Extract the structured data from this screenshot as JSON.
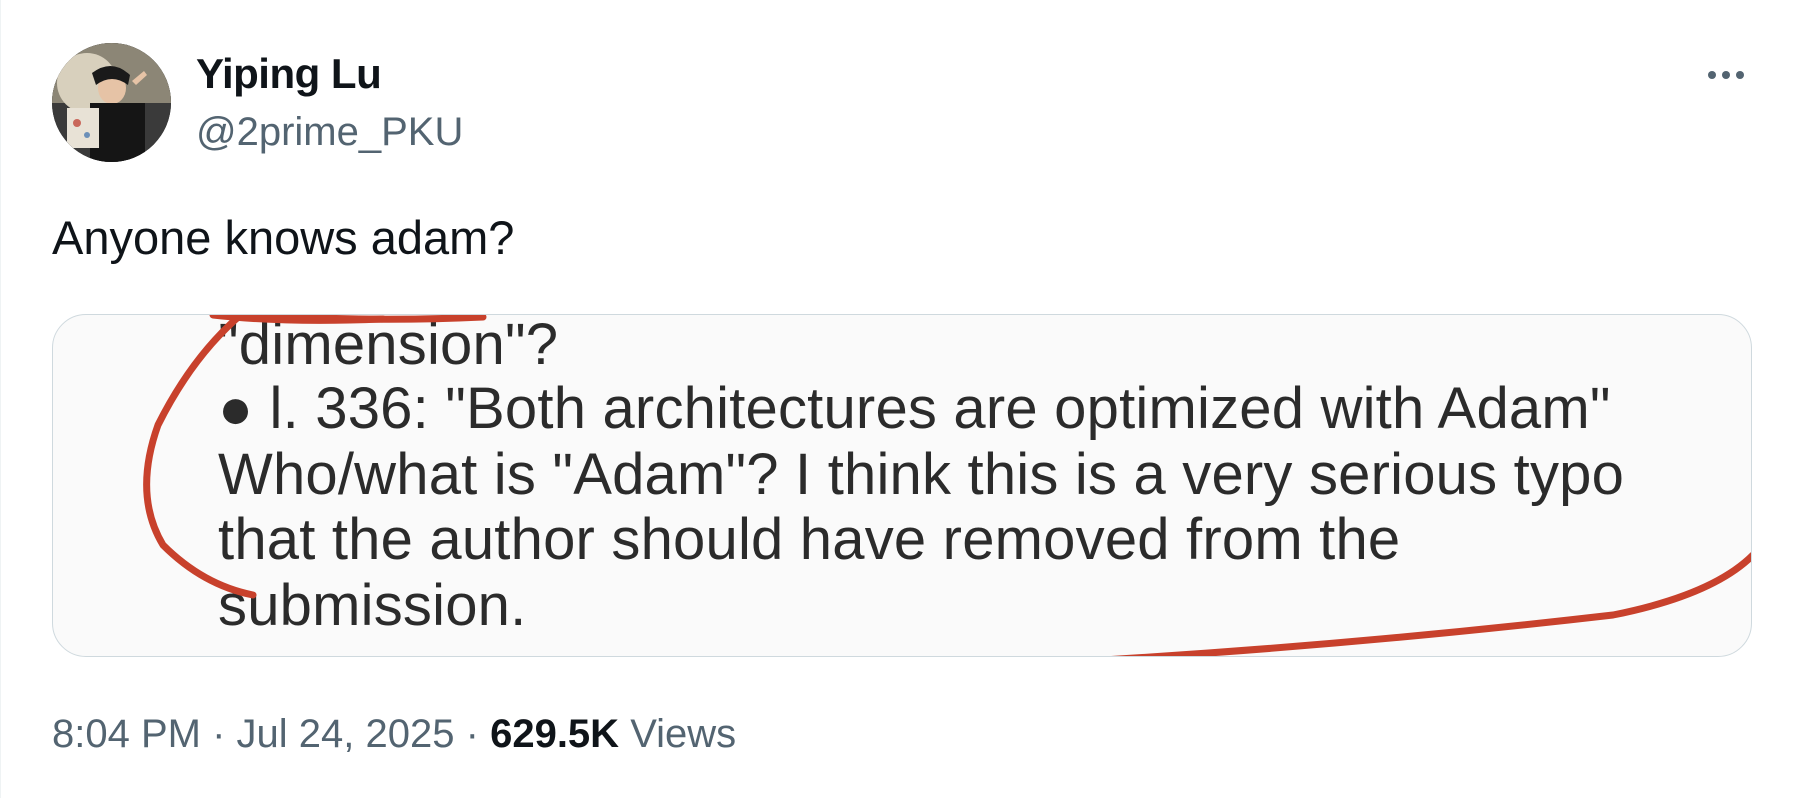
{
  "author": {
    "display_name": "Yiping Lu",
    "handle": "@2prime_PKU",
    "avatar_icon": "avatar-photo"
  },
  "more_icon": "more-horizontal-icon",
  "tweet": {
    "text": "Anyone knows adam?"
  },
  "media": {
    "lines": [
      "\"dimension\"?",
      "● l. 336: \"Both architectures are optimized with Adam\"",
      "Who/what is \"Adam\"? I think this is a very serious typo",
      "that the author should have removed from the",
      "submission."
    ],
    "annotation_color": "#c8412c"
  },
  "meta": {
    "time": "8:04 PM",
    "separator": "·",
    "date": "Jul 24, 2025",
    "views_count": "629.5K",
    "views_label": "Views"
  },
  "colors": {
    "text_primary": "#0f1419",
    "text_secondary": "#536471",
    "border": "#cfd9de"
  }
}
